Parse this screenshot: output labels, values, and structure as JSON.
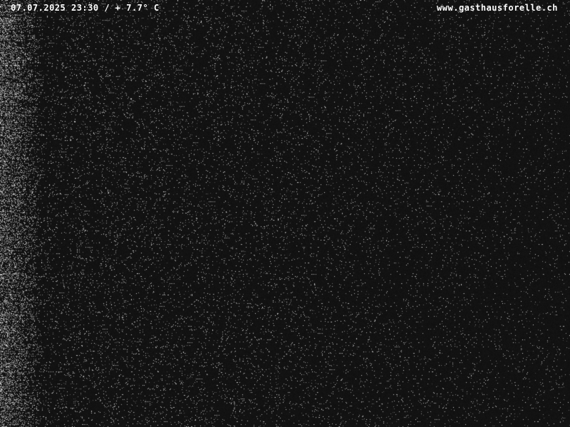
{
  "overlay": {
    "timestamp_temperature": "07.07.2025 23:30 / + 7.7° C",
    "website": "www.gasthausforelle.ch"
  },
  "colors": {
    "background": "#101010",
    "noise": "#ffffff",
    "overlay_text": "#ffffff"
  }
}
